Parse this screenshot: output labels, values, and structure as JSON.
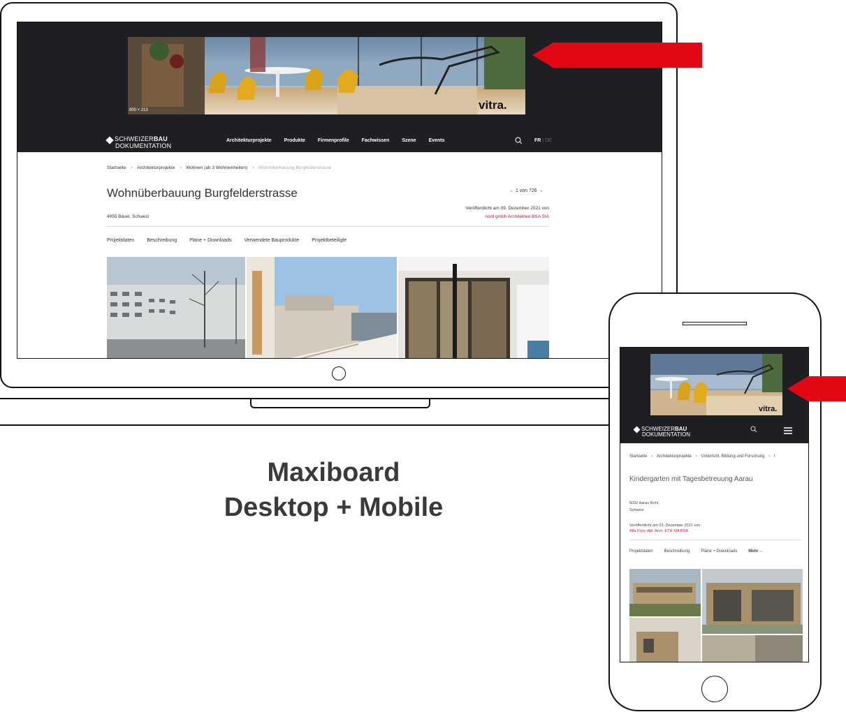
{
  "desktop": {
    "ad": {
      "size_label": "800 × 213",
      "brand": "vitra."
    },
    "logo": {
      "line1_light": "SCHWEIZER",
      "line1_bold": "BAU",
      "line2": "DOKUMENTATION"
    },
    "nav": [
      "Architekturprojekte",
      "Produkte",
      "Firmenprofile",
      "Fachwissen",
      "Szene",
      "Events"
    ],
    "lang": {
      "active": "FR",
      "separator": "|",
      "inactive": "DE"
    },
    "breadcrumb": [
      "Startseite",
      "Architekturprojekte",
      "Wohnen (ab 3 Wohneinheiten)",
      "Wohnüberbauung Burgfelderstrasse"
    ],
    "breadcrumb_sep": ">",
    "title": "Wohnüberbauung Burgfelderstrasse",
    "pager": {
      "prev": "←",
      "text": "1 von 726",
      "next": "→"
    },
    "published": "Veröffentlicht am 09. Dezember 2021 von",
    "author": "nord gmbh Architekten BSA SIA",
    "location": "4055 Basel, Schweiz",
    "tabs": [
      "Projektdaten",
      "Beschreibung",
      "Pläne + Downloads",
      "Verwendete Bauprodukte",
      "Projektbeteiligte"
    ]
  },
  "mobile": {
    "ad": {
      "brand": "vitra."
    },
    "logo": {
      "line1_light": "SCHWEIZER",
      "line1_bold": "BAU",
      "line2": "DOKUMENTATION"
    },
    "breadcrumb": [
      "Startseite",
      "Architekturprojekte",
      "Unterricht, Bildung und Forschung",
      "I"
    ],
    "breadcrumb_sep": ">",
    "title": "Kindergarten mit Tagesbetreuung Aarau",
    "location_line1": "5032 Aarau Rohr,",
    "location_line2": "Schweiz",
    "published": "Veröffentlicht am 03. Dezember 2021 von",
    "author": "Alfa Flury dipl. Arch. ETH SIA BSA",
    "tabs": [
      "Projektdaten",
      "Beschreibung",
      "Pläne + Downloads"
    ],
    "more_label": "Mehr"
  },
  "caption": {
    "line1": "Maxiboard",
    "line2": "Desktop + Mobile"
  },
  "colors": {
    "header_bg": "#1e1f22",
    "accent_red": "#e30613",
    "link_red": "#c8102e"
  }
}
